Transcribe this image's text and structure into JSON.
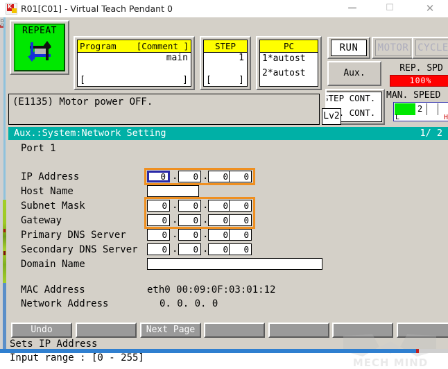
{
  "window": {
    "title": "R01[C01] - Virtual Teach Pendant 0",
    "minimize": "—",
    "maximize": "☐",
    "close": "✕"
  },
  "header": {
    "mode_button": {
      "label": "REPEAT",
      "icon": "cycle-arrows-icon",
      "color": "#00e800"
    },
    "program": {
      "header_left": "Program",
      "header_right": "[Comment ]",
      "value": "main",
      "bracket_left": "[",
      "bracket_right": "]"
    },
    "step": {
      "header": "STEP",
      "value": "1",
      "bracket_left": "[",
      "bracket_right": "]"
    },
    "pc": {
      "header": "PC",
      "line1": "1*autost",
      "line2": "2*autost"
    },
    "lamps": [
      {
        "label": "RUN",
        "active": true
      },
      {
        "label": "MOTOR",
        "active": false
      },
      {
        "label": "CYCLE",
        "active": false
      }
    ],
    "aux_button": "Aux.",
    "cont_box": {
      "line1": "STEP CONT.",
      "line2": "REP. CONT."
    },
    "rep_spd": {
      "label": "REP. SPD",
      "value": "100%",
      "color": "#ff0000"
    },
    "man_speed": {
      "label": "MAN. SPEED",
      "value": "2",
      "low": "L",
      "high": "H",
      "fill_percent": 37,
      "fill_color": "#00e800"
    }
  },
  "message": {
    "text": "(E1135) Motor power OFF.",
    "level_badge": "Lv2"
  },
  "screen": {
    "title": "Aux.:System:Network Setting",
    "page": "1/  2",
    "accent": "#00b0a6"
  },
  "form": {
    "port_label": "Port 1",
    "selection_color": "#ef8f20",
    "focus_color": "#2a2aa8",
    "rows": [
      {
        "label": "IP Address",
        "type": "octets",
        "values": [
          "0",
          "0",
          "0",
          "0"
        ],
        "selected": true,
        "focused_index": 0
      },
      {
        "label": "Host Name",
        "type": "text",
        "value": "",
        "selected": false
      },
      {
        "label": "Subnet Mask",
        "type": "octets",
        "values": [
          "0",
          "0",
          "0",
          "0"
        ],
        "selected": true,
        "focused_index": -1
      },
      {
        "label": "Gateway",
        "type": "octets",
        "values": [
          "0",
          "0",
          "0",
          "0"
        ],
        "selected": true,
        "focused_index": -1
      },
      {
        "label": "Primary DNS Server",
        "type": "octets",
        "values": [
          "0",
          "0",
          "0",
          "0"
        ],
        "selected": false,
        "focused_index": -1
      },
      {
        "label": "Secondary DNS Server",
        "type": "octets",
        "values": [
          "0",
          "0",
          "0",
          "0"
        ],
        "selected": false,
        "focused_index": -1
      },
      {
        "label": "Domain Name",
        "type": "text",
        "value": "",
        "selected": false
      }
    ],
    "separator": ".",
    "readonly": [
      {
        "label": "MAC Address",
        "value": "eth0 00:09:0F:03:01:12"
      },
      {
        "label": "Network Address",
        "value": "0.  0.  0.  0"
      }
    ]
  },
  "function_keys": [
    {
      "label": "Undo"
    },
    {
      "label": ""
    },
    {
      "label": "Next Page"
    },
    {
      "label": ""
    },
    {
      "label": ""
    },
    {
      "label": ""
    },
    {
      "label": ""
    }
  ],
  "status": {
    "line1": "Sets IP Address",
    "line2": "Input range : [0  - 255]"
  },
  "watermark": {
    "text": "MECH MIND"
  }
}
